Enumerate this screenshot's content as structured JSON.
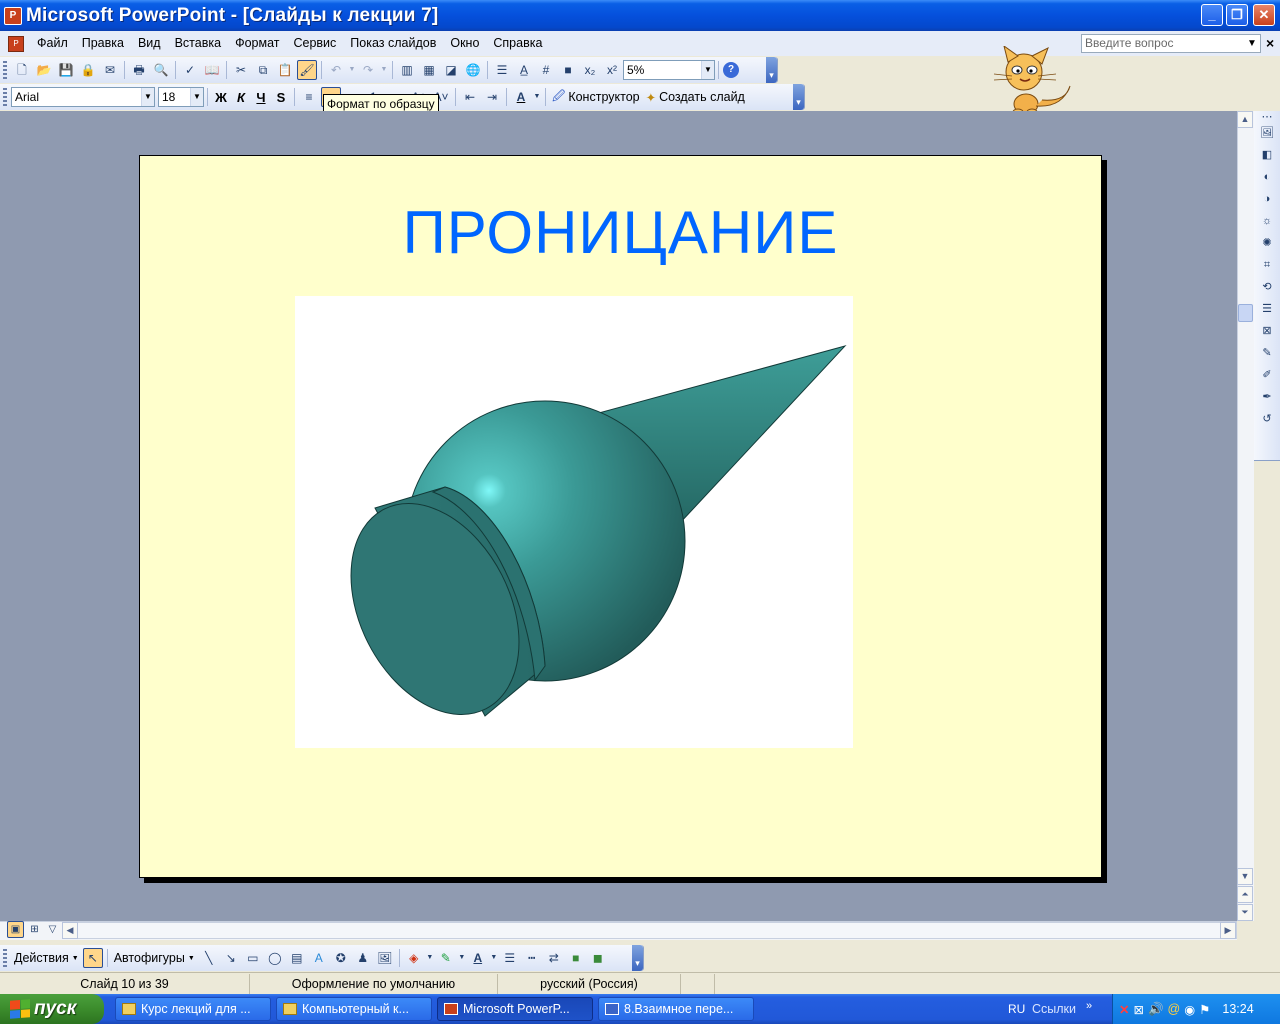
{
  "window": {
    "title": "Microsoft PowerPoint - [Слайды к лекции 7]",
    "min_label": "_",
    "restore_label": "❐",
    "close_label": "✕"
  },
  "menu": {
    "items": [
      "Файл",
      "Правка",
      "Вид",
      "Вставка",
      "Формат",
      "Сервис",
      "Показ слайдов",
      "Окно",
      "Справка"
    ],
    "ask_placeholder": "Введите вопрос"
  },
  "standard_toolbar": {
    "zoom_value": "5%"
  },
  "format_toolbar": {
    "font_name": "Arial",
    "font_size": "18",
    "bold_label": "Ж",
    "italic_label": "К",
    "underline_label": "Ч",
    "shadow_label": "S",
    "designer_label": "Конструктор",
    "new_slide_label": "Создать слайд"
  },
  "tooltip": {
    "text": "Формат по образцу"
  },
  "slide": {
    "title": "ПРОНИЦАНИЕ"
  },
  "drawing_toolbar": {
    "actions_label": "Действия",
    "autoshapes_label": "Автофигуры"
  },
  "status_bar": {
    "slide_counter": "Слайд 10 из 39",
    "design": "Оформление по умолчанию",
    "language": "русский (Россия)"
  },
  "taskbar": {
    "start_label": "пуск",
    "tasks": [
      {
        "label": "Курс лекций для ..."
      },
      {
        "label": "Компьютерный к..."
      },
      {
        "label": "Microsoft PowerP..."
      },
      {
        "label": "8.Взаимное пере..."
      }
    ],
    "language_indicator": "RU",
    "links_label": "Ссылки",
    "clock": "13:24"
  },
  "colors": {
    "slide_background": "#ffffcc",
    "title_color": "#0066ff",
    "solid_color": "#2f7c7a",
    "workspace": "#8f9ab0"
  }
}
